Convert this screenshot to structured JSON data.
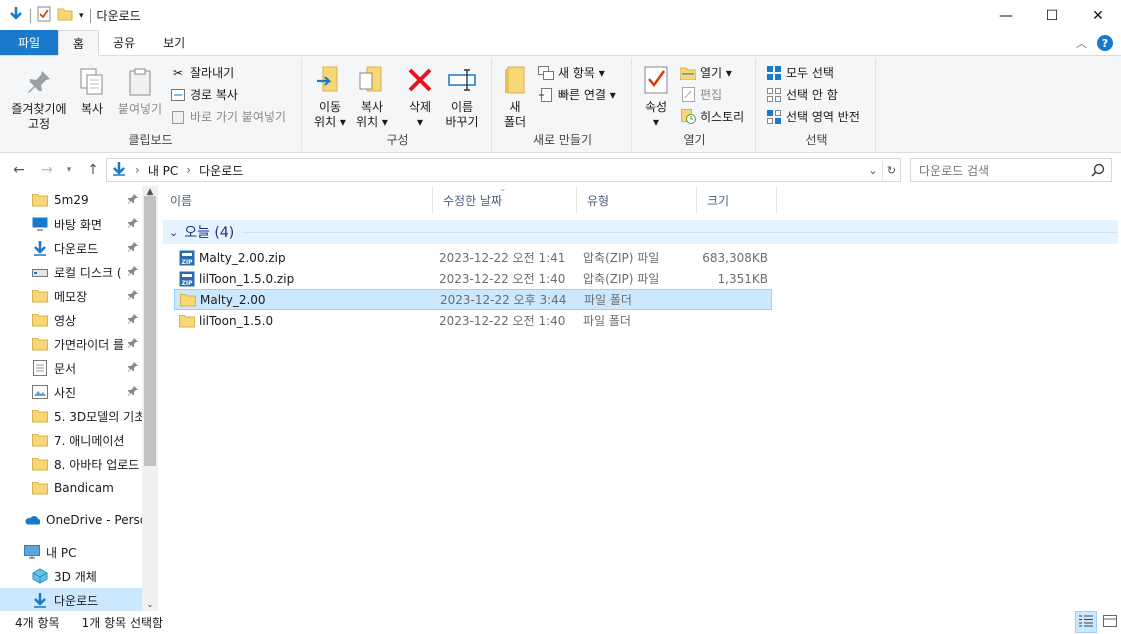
{
  "window": {
    "title": "다운로드",
    "buttons": {
      "minimize": "—",
      "maximize": "☐",
      "close": "✕"
    }
  },
  "ribbon_tabs": [
    "파일",
    "홈",
    "공유",
    "보기"
  ],
  "ribbon": {
    "clipboard": {
      "pin": "즐겨찾기에\n고정",
      "copy": "복사",
      "paste": "붙여넣기",
      "cut": "잘라내기",
      "copy_path": "경로 복사",
      "paste_shortcut": "바로 가기 붙여넣기",
      "label": "클립보드"
    },
    "organize": {
      "move": "이동\n위치 ▾",
      "copyto": "복사\n위치 ▾",
      "delete": "삭제\n▾",
      "rename": "이름\n바꾸기",
      "label": "구성"
    },
    "new": {
      "new_folder": "새\n폴더",
      "new_item": "새 항목 ▾",
      "easy_access": "빠른 연결 ▾",
      "label": "새로 만들기"
    },
    "open": {
      "properties": "속성\n▾",
      "open": "열기 ▾",
      "edit": "편집",
      "history": "히스토리",
      "label": "열기"
    },
    "select": {
      "select_all": "모두 선택",
      "select_none": "선택 안 함",
      "invert": "선택 영역 반전",
      "label": "선택"
    }
  },
  "address": {
    "crumbs": [
      "내 PC",
      "다운로드"
    ],
    "search_placeholder": "다운로드 검색"
  },
  "nav": [
    {
      "label": "5m29",
      "icon": "folder-icon",
      "pinned": true
    },
    {
      "label": "바탕 화면",
      "icon": "desktop-icon",
      "pinned": true
    },
    {
      "label": "다운로드",
      "icon": "download-icon",
      "pinned": true
    },
    {
      "label": "로컬 디스크 (",
      "icon": "drive-icon",
      "pinned": true
    },
    {
      "label": "메모장",
      "icon": "folder-icon",
      "pinned": true
    },
    {
      "label": "영상",
      "icon": "folder-icon",
      "pinned": true
    },
    {
      "label": "가면라이더 를",
      "icon": "folder-icon",
      "pinned": true
    },
    {
      "label": "문서",
      "icon": "documents-icon",
      "pinned": true
    },
    {
      "label": "사진",
      "icon": "pictures-icon",
      "pinned": true
    },
    {
      "label": "5. 3D모델의 기초",
      "icon": "folder-icon",
      "pinned": false
    },
    {
      "label": "7. 애니메이션",
      "icon": "folder-icon",
      "pinned": false
    },
    {
      "label": "8. 아바타 업로드",
      "icon": "folder-icon",
      "pinned": false
    },
    {
      "label": "Bandicam",
      "icon": "folder-icon",
      "pinned": false
    },
    {
      "label": "OneDrive - Person",
      "icon": "onedrive-icon",
      "pinned": false
    },
    {
      "label": "내 PC",
      "icon": "pc-icon",
      "pinned": false
    },
    {
      "label": "3D 개체",
      "icon": "3d-objects-icon",
      "pinned": false
    },
    {
      "label": "다운로드",
      "icon": "download-icon",
      "pinned": false
    }
  ],
  "columns": [
    "이름",
    "수정한 날짜",
    "유형",
    "크기"
  ],
  "group": "오늘 (4)",
  "files": [
    {
      "name": "Malty_2.00.zip",
      "date": "2023-12-22 오전 1:41",
      "type": "압축(ZIP) 파일",
      "size": "683,308KB",
      "icon": "zip-icon"
    },
    {
      "name": "lilToon_1.5.0.zip",
      "date": "2023-12-22 오전 1:40",
      "type": "압축(ZIP) 파일",
      "size": "1,351KB",
      "icon": "zip-icon"
    },
    {
      "name": "Malty_2.00",
      "date": "2023-12-22 오후 3:44",
      "type": "파일 폴더",
      "size": "",
      "icon": "folder-icon"
    },
    {
      "name": "lilToon_1.5.0",
      "date": "2023-12-22 오전 1:40",
      "type": "파일 폴더",
      "size": "",
      "icon": "folder-icon"
    }
  ],
  "status": {
    "count": "4개 항목",
    "selected": "1개 항목 선택함"
  },
  "colors": {
    "accent": "#1979ca",
    "selection": "#cce8ff",
    "folder": "#f8d775"
  }
}
